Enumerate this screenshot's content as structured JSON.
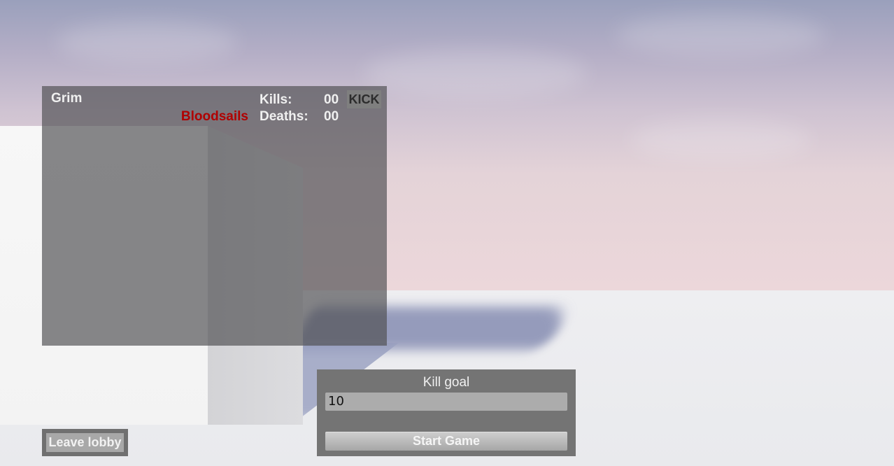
{
  "player": {
    "name": "Grim",
    "team": "Bloodsails",
    "team_color": "#b00000",
    "kills_label": "Kills:",
    "kills_value": "00",
    "deaths_label": "Deaths:",
    "deaths_value": "00",
    "kick_label": "KICK"
  },
  "lobby": {
    "leave_label": "Leave lobby"
  },
  "settings": {
    "kill_goal_label": "Kill goal",
    "kill_goal_value": "10",
    "start_label": "Start Game"
  }
}
